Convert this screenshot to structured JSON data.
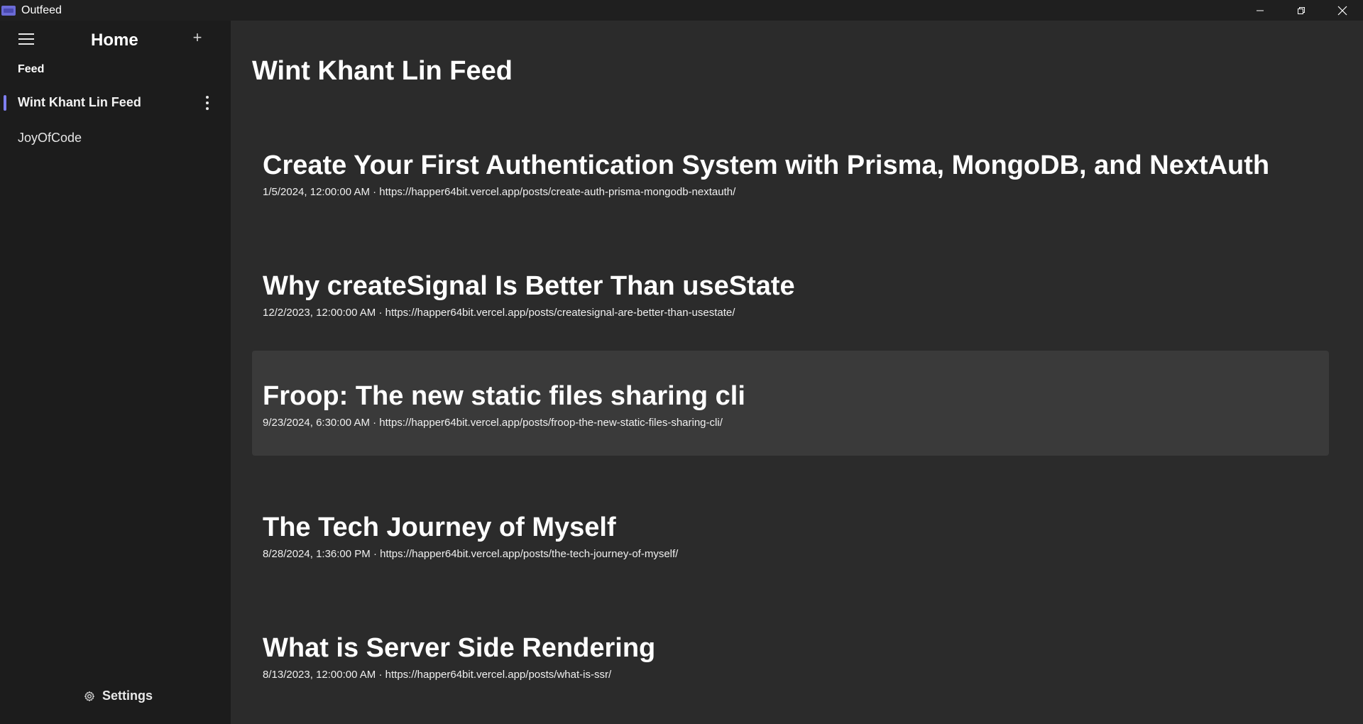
{
  "window": {
    "title": "Outfeed",
    "controls": [
      "minimize-icon",
      "restore-icon",
      "close-icon"
    ]
  },
  "sidebar": {
    "title": "Home",
    "section_label": "Feed",
    "items": [
      {
        "label": "Wint Khant Lin Feed",
        "active": true
      },
      {
        "label": "JoyOfCode",
        "active": false
      }
    ],
    "settings_label": "Settings",
    "accent": "#7f7ff0"
  },
  "main": {
    "title": "Wint Khant Lin Feed",
    "posts": [
      {
        "title": "Create Your First Authentication System with Prisma, MongoDB, and NextAuth",
        "date": "1/5/2024, 12:00:00 AM",
        "url": "https://happer64bit.vercel.app/posts/create-auth-prisma-mongodb-nextauth/"
      },
      {
        "title": "Why createSignal Is Better Than useState",
        "date": "12/2/2023, 12:00:00 AM",
        "url": "https://happer64bit.vercel.app/posts/createsignal-are-better-than-usestate/"
      },
      {
        "title": "Froop: The new static files sharing cli",
        "date": "9/23/2024, 6:30:00 AM",
        "url": "https://happer64bit.vercel.app/posts/froop-the-new-static-files-sharing-cli/",
        "hovered": true
      },
      {
        "title": "The Tech Journey of Myself",
        "date": "8/28/2024, 1:36:00 PM",
        "url": "https://happer64bit.vercel.app/posts/the-tech-journey-of-myself/"
      },
      {
        "title": "What is Server Side Rendering",
        "date": "8/13/2023, 12:00:00 AM",
        "url": "https://happer64bit.vercel.app/posts/what-is-ssr/"
      }
    ],
    "meta_separator": " · "
  }
}
